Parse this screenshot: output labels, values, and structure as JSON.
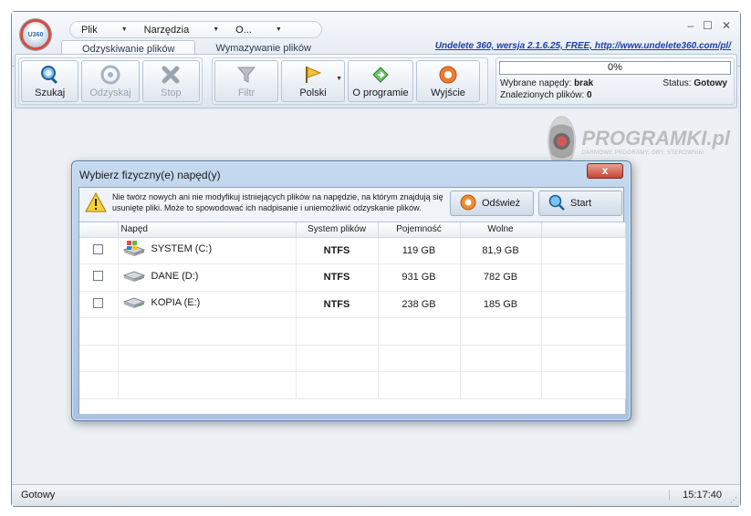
{
  "menu": {
    "items": [
      {
        "label": "Plik"
      },
      {
        "label": "Narzędzia"
      },
      {
        "label": "O..."
      }
    ]
  },
  "tabs": [
    {
      "label": "Odzyskiwanie plików",
      "active": true
    },
    {
      "label": "Wymazywanie plików",
      "active": false
    }
  ],
  "header": {
    "link": "Undelete 360, wersja 2.1.6.25, FREE, http://www.undelete360.com/pl/",
    "logo_text": "U360"
  },
  "toolbar": {
    "search": "Szukaj",
    "recover": "Odzyskaj",
    "stop": "Stop",
    "filter": "Filtr",
    "language": "Polski",
    "about": "O programie",
    "exit": "Wyjście"
  },
  "status_panel": {
    "progress_text": "0%",
    "progress_value": 0,
    "drives_label": "Wybrane napędy:",
    "drives_value": "brak",
    "found_label": "Znalezionych plików:",
    "found_value": "0",
    "status_label": "Status:",
    "status_value": "Gotowy"
  },
  "watermark": {
    "title": "PROGRAMKI.pl",
    "subtitle": "DARMOWE PROGRAMY, GRY, STEROWNIKI"
  },
  "dialog": {
    "title": "Wybierz fizyczny(e) napęd(y)",
    "close": "x",
    "warning": "Nie twórz nowych ani nie modyfikuj istniejących plików na napędzie, na którym znajdują się usunięte pliki. Może to spowodować ich nadpisanie i uniemożliwić odzyskanie plików.",
    "refresh": "Odśwież",
    "start": "Start",
    "columns": [
      "",
      "Napęd",
      "System plików",
      "Pojemność",
      "Wolne"
    ],
    "drives": [
      {
        "name": "SYSTEM (C:)",
        "fs": "NTFS",
        "capacity": "119 GB",
        "free": "81,9 GB",
        "icon": "windows-drive-icon"
      },
      {
        "name": "DANE (D:)",
        "fs": "NTFS",
        "capacity": "931 GB",
        "free": "782 GB",
        "icon": "hard-drive-icon"
      },
      {
        "name": "KOPIA (E:)",
        "fs": "NTFS",
        "capacity": "238 GB",
        "free": "185 GB",
        "icon": "hard-drive-icon"
      }
    ]
  },
  "statusbar": {
    "text": "Gotowy",
    "time": "15:17:40"
  },
  "colors": {
    "accent": "#1b3fa7",
    "dialog_frame": "#a9c4e2",
    "close_red": "#c74532"
  }
}
